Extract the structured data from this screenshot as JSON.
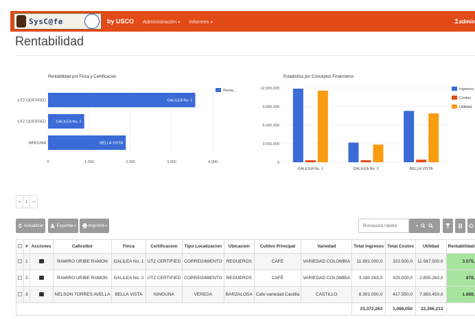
{
  "nav": {
    "logo_text": "SysC@fe",
    "brand_by": "by USCO",
    "menu": [
      {
        "label": "Administración"
      },
      {
        "label": "Informes"
      }
    ],
    "caret": "▾",
    "user": "admin"
  },
  "page_title": "Rentabilidad",
  "charts": {
    "bar_title": "Rentabilidad por Finca y Certificacion",
    "column_title": "Estadistica por Conceptos Financieros"
  },
  "chart_data": [
    {
      "type": "bar",
      "orientation": "horizontal",
      "categories": [
        "UTZ CERTIFIED",
        "UTZ CERTIFIED",
        "NINGUNA"
      ],
      "bar_labels": [
        "GALILEA No. 1",
        "GALILEA No. 2",
        "BELLA VISTA"
      ],
      "values": [
        3575,
        878,
        1888
      ],
      "xlim": [
        0,
        4000
      ],
      "x_ticks": [
        "0",
        "1,000",
        "2,000",
        "3,000",
        "4,000"
      ],
      "series": [
        {
          "name": "Renta...",
          "color": "#3a6bd6"
        }
      ],
      "legend_position": "top-right"
    },
    {
      "type": "bar",
      "orientation": "vertical",
      "categories": [
        "GALILEA No. 1",
        "GALILEA No. 2",
        "BELLA VISTA"
      ],
      "series": [
        {
          "name": "Ingresos",
          "values": [
            11891000,
            3180263,
            8301000
          ],
          "color": "#3a6bd6"
        },
        {
          "name": "Costos",
          "values": [
            323500,
            325000,
            417550
          ],
          "color": "#e24a18"
        },
        {
          "name": "Utilidad",
          "values": [
            11567500,
            2855263,
            7883450
          ],
          "color": "#f89c12"
        }
      ],
      "ylim": [
        0,
        12000000
      ],
      "y_ticks": [
        "0",
        "3,000,000",
        "6,000,000",
        "9,000,000",
        "12,000,000"
      ],
      "legend_position": "right"
    }
  ],
  "pager": [
    "«",
    "1",
    "»"
  ],
  "toolbar": {
    "refresh": "Actualizar",
    "export": "Exportar",
    "print": "Imprimir",
    "search_placeholder": "Búsqueda rapida"
  },
  "table": {
    "headers": [
      "",
      "#",
      "Acciones",
      "Caficultor",
      "Finca",
      "Certificacion",
      "Tipo Localizacion",
      "Ubicacion",
      "Cultivo Principal",
      "Variedad",
      "Total Ingresos",
      "Total Costos",
      "Utilidad",
      "Rentabilidad"
    ],
    "rows": [
      [
        "1",
        "RAMIRO URIBE RAMON",
        "GALILEA No. 1",
        "UTZ CERTIFIED",
        "CORREGIMIENTO",
        "REGUEROS",
        "CAFE",
        "VARIEDAD COLOMBIA",
        "11.891.000,0",
        "323.500,0",
        "11.567.500,0",
        "3.575,"
      ],
      [
        "2",
        "RAMIRO URIBE RAMON",
        "GALILEA No. 2",
        "UTZ CERTIFIED",
        "CORREGIMIENTO",
        "REGUEROS",
        "CAFÉ",
        "VARIEDAD COLOMBIA",
        "3.180.263,0",
        "325.000,0",
        "2.855.263,0",
        "878,"
      ],
      [
        "3",
        "NELSON TORRES AVELLA",
        "BELLA VISTA",
        "NINGUNA",
        "VEREDA",
        "BARZALOSA",
        "Cafe variedad Castilla",
        "CASTILLO",
        "8.301.000,0",
        "417.550,0",
        "7.883.450,0",
        "1.888,"
      ]
    ],
    "totals": {
      "ingresos": "23,372,263",
      "costos": "1,066,050",
      "utilidad": "22,306,213"
    }
  }
}
